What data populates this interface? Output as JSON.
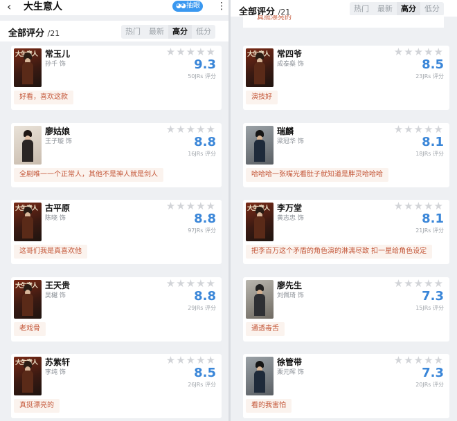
{
  "left": {
    "header": {
      "back_icon": "back-arrow-icon",
      "title": "大生意人",
      "pill_label": "抽眼",
      "more_icon": "more-icon"
    },
    "filter": {
      "title": "全部评分",
      "count": "/21",
      "tabs": [
        "热门",
        "最新",
        "高分",
        "低分"
      ],
      "active": "高分"
    },
    "cards": [
      {
        "name": "常玉儿",
        "actor": "孙千 饰",
        "score": "9.3",
        "votes": "50JRs 评分",
        "comment": "好看，喜欢这款",
        "poster": "drama"
      },
      {
        "name": "廖姑娘",
        "actor": "王子璇 饰",
        "score": "8.8",
        "votes": "16JRs 评分",
        "comment": "全剧唯一一个正常人，其他不是神人就是剑人",
        "poster": "woman"
      },
      {
        "name": "古平原",
        "actor": "陈晓 饰",
        "score": "8.8",
        "votes": "97JRs 评分",
        "comment": "这哥们我是真喜欢他",
        "poster": "drama"
      },
      {
        "name": "王天贵",
        "actor": "吴樾 饰",
        "score": "8.8",
        "votes": "29JRs 评分",
        "comment": "老戏骨",
        "poster": "drama"
      },
      {
        "name": "苏紫轩",
        "actor": "李纯 饰",
        "score": "8.5",
        "votes": "26JRs 评分",
        "comment": "真挺漂亮的",
        "poster": "drama"
      }
    ]
  },
  "right": {
    "filter": {
      "title": "全部评分",
      "count": "/21",
      "tabs": [
        "热门",
        "最新",
        "高分",
        "低分"
      ],
      "active": "高分"
    },
    "peek_comment": "真挺漂亮的",
    "cards": [
      {
        "name": "常四爷",
        "actor": "成泰燊 饰",
        "score": "8.5",
        "votes": "23JRs 评分",
        "comment": "演技好",
        "poster": "drama"
      },
      {
        "name": "瑞麟",
        "actor": "梁冠华 饰",
        "score": "8.1",
        "votes": "18JRs 评分",
        "comment": "哈哈哈一张嘴光看肚子就知道是胖灵哈哈哈",
        "poster": "official"
      },
      {
        "name": "李万堂",
        "actor": "黄志忠 饰",
        "score": "8.1",
        "votes": "21JRs 评分",
        "comment": "把李百万这个矛盾的角色演的淋漓尽致 扣一星给角色设定",
        "poster": "drama"
      },
      {
        "name": "廖先生",
        "actor": "刘佩琦 饰",
        "score": "7.3",
        "votes": "15JRs 评分",
        "comment": "通透毒舌",
        "poster": "man"
      },
      {
        "name": "徐管带",
        "actor": "栗元晖 饰",
        "score": "7.3",
        "votes": "20JRs 评分",
        "comment": "看的我害怕",
        "poster": "official"
      }
    ]
  },
  "ui": {
    "poster_title": "大生意人",
    "stars": "★★★★★",
    "accent": "#3a86d8",
    "comment_color": "#c4583a",
    "pill_color": "#3a98f0"
  }
}
